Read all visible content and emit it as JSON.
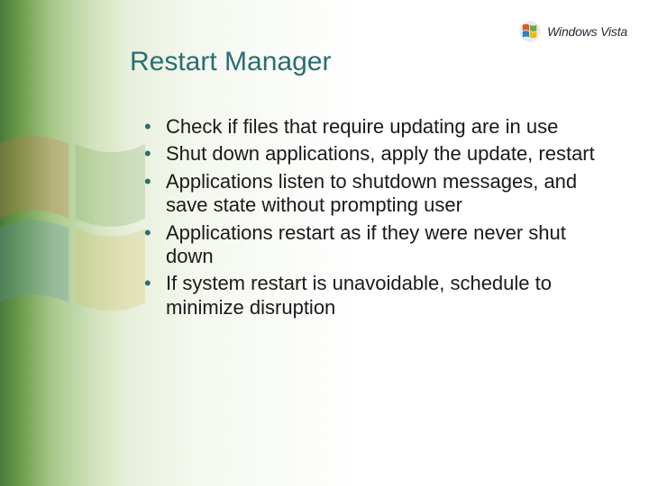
{
  "logo": {
    "text_prefix": "Windows",
    "text_suffix": "Vista"
  },
  "title": "Restart Manager",
  "bullets": [
    "Check if files that require updating are in use",
    "Shut down applications, apply the update, restart",
    "Applications listen to shutdown messages, and save state without prompting user",
    "Applications restart as if they were never shut down",
    "If system restart is unavoidable, schedule to minimize disruption"
  ]
}
